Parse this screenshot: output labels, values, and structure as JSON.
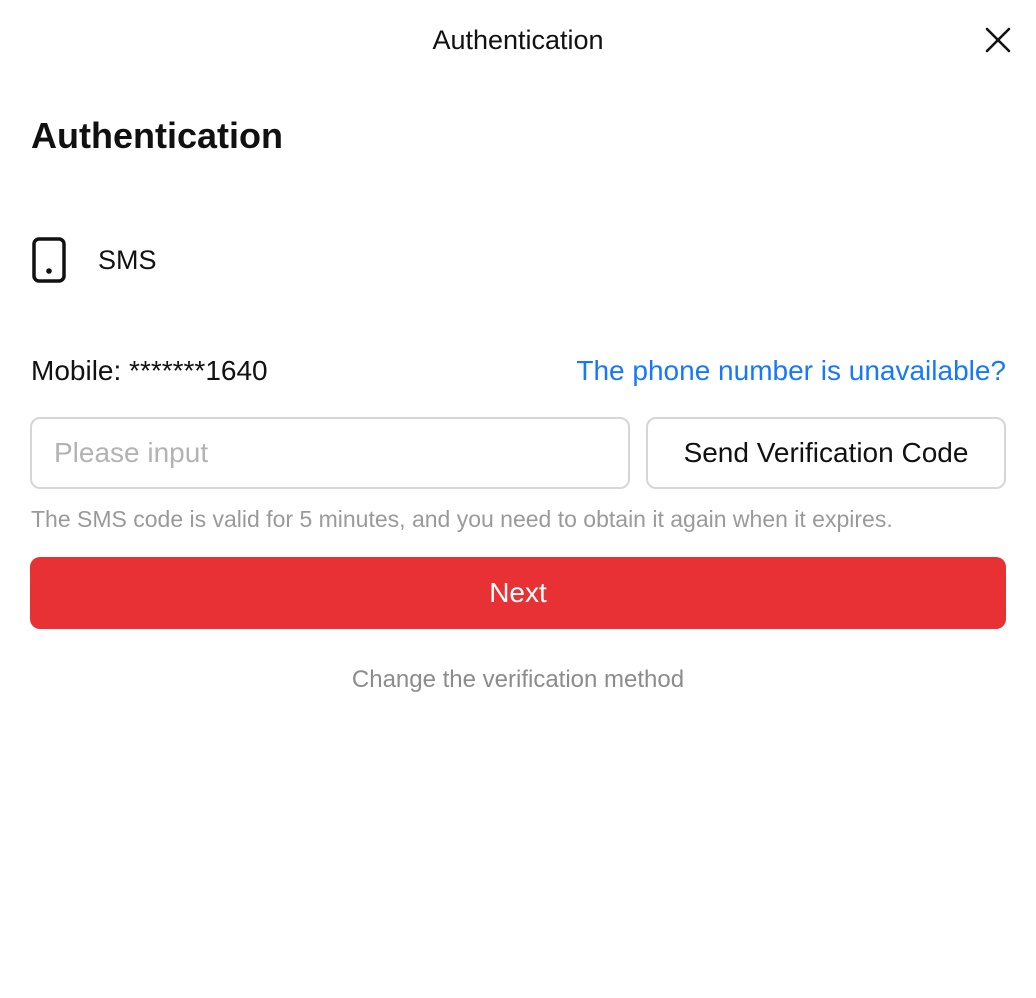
{
  "dialog": {
    "title": "Authentication",
    "close_icon": "close-icon"
  },
  "page": {
    "heading": "Authentication"
  },
  "method": {
    "icon": "mobile-phone-icon",
    "label": "SMS"
  },
  "mobile": {
    "label": "Mobile: *******1640",
    "unavailable_link": "The phone number is unavailable?"
  },
  "code_input": {
    "value": "",
    "placeholder": "Please input"
  },
  "send_code_button": {
    "label": "Send Verification Code"
  },
  "hint": "The SMS code is valid for 5 minutes, and you need to obtain it again when it expires.",
  "next_button": {
    "label": "Next"
  },
  "change_method_link": "Change the verification method",
  "colors": {
    "accent_link": "#1677ff",
    "primary_button": "#e83135",
    "hint_text": "#9a9a9a"
  }
}
